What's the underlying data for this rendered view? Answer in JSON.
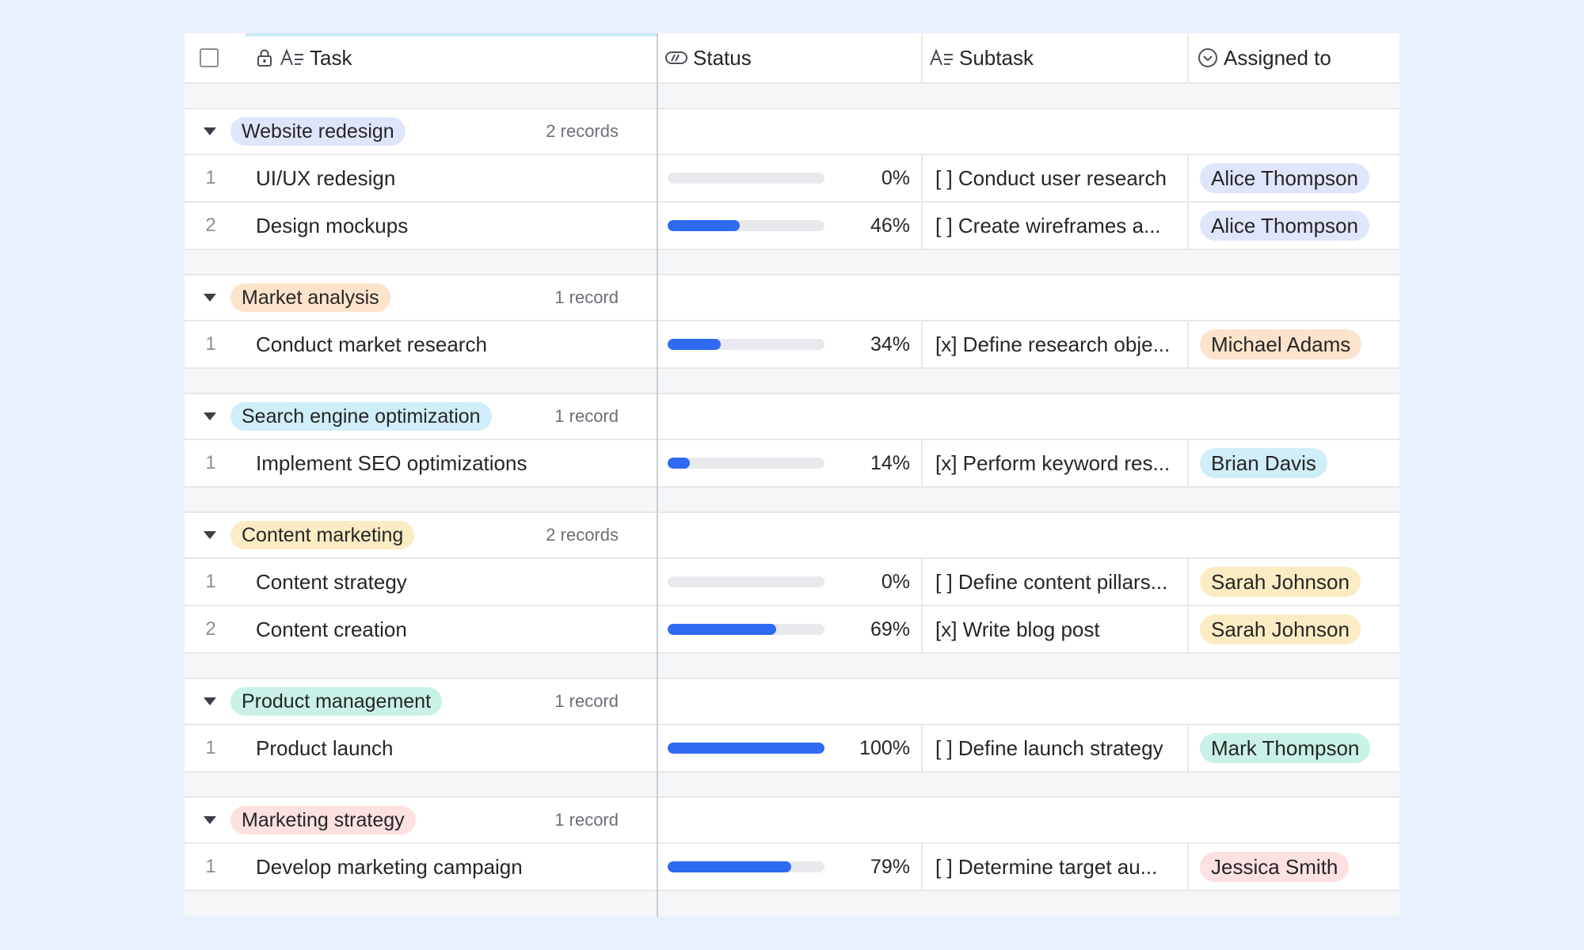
{
  "header": {
    "task": "Task",
    "status": "Status",
    "subtask": "Subtask",
    "assigned": "Assigned to"
  },
  "colors": {
    "progress": "#2f6af2",
    "track": "#e8e9ec"
  },
  "groups": [
    {
      "name": "Website redesign",
      "count": "2 records",
      "pill_color": "#dfe6fb",
      "person_color": "#dfe6fb",
      "rows": [
        {
          "num": "1",
          "task": "UI/UX redesign",
          "progress": 0,
          "pct": "0%",
          "subtask": "[ ] Conduct user research",
          "person": "Alice Thompson"
        },
        {
          "num": "2",
          "task": "Design mockups",
          "progress": 46,
          "pct": "46%",
          "subtask": "[ ] Create wireframes a...",
          "person": "Alice Thompson"
        }
      ]
    },
    {
      "name": "Market analysis",
      "count": "1 record",
      "pill_color": "#fde3cb",
      "person_color": "#fde3cb",
      "rows": [
        {
          "num": "1",
          "task": "Conduct market research",
          "progress": 34,
          "pct": "34%",
          "subtask": "[x] Define research obje...",
          "person": "Michael Adams"
        }
      ]
    },
    {
      "name": "Search engine optimization",
      "count": "1 record",
      "pill_color": "#cfeef9",
      "person_color": "#cfeef9",
      "rows": [
        {
          "num": "1",
          "task": "Implement SEO optimizations",
          "progress": 14,
          "pct": "14%",
          "subtask": "[x] Perform keyword res...",
          "person": "Brian Davis"
        }
      ]
    },
    {
      "name": "Content marketing",
      "count": "2 records",
      "pill_color": "#fcecc4",
      "person_color": "#fcecc4",
      "rows": [
        {
          "num": "1",
          "task": "Content strategy",
          "progress": 0,
          "pct": "0%",
          "subtask": "[ ] Define content pillars...",
          "person": "Sarah Johnson"
        },
        {
          "num": "2",
          "task": "Content creation",
          "progress": 69,
          "pct": "69%",
          "subtask": "[x] Write blog post",
          "person": "Sarah Johnson"
        }
      ]
    },
    {
      "name": "Product management",
      "count": "1 record",
      "pill_color": "#c9f1e7",
      "person_color": "#c9f1e7",
      "rows": [
        {
          "num": "1",
          "task": "Product launch",
          "progress": 100,
          "pct": "100%",
          "subtask": "[ ] Define launch strategy",
          "person": "Mark Thompson"
        }
      ]
    },
    {
      "name": "Marketing strategy",
      "count": "1 record",
      "pill_color": "#fde0e0",
      "person_color": "#fde0e0",
      "rows": [
        {
          "num": "1",
          "task": "Develop marketing campaign",
          "progress": 79,
          "pct": "79%",
          "subtask": "[ ] Determine target au...",
          "person": "Jessica Smith"
        }
      ]
    }
  ]
}
